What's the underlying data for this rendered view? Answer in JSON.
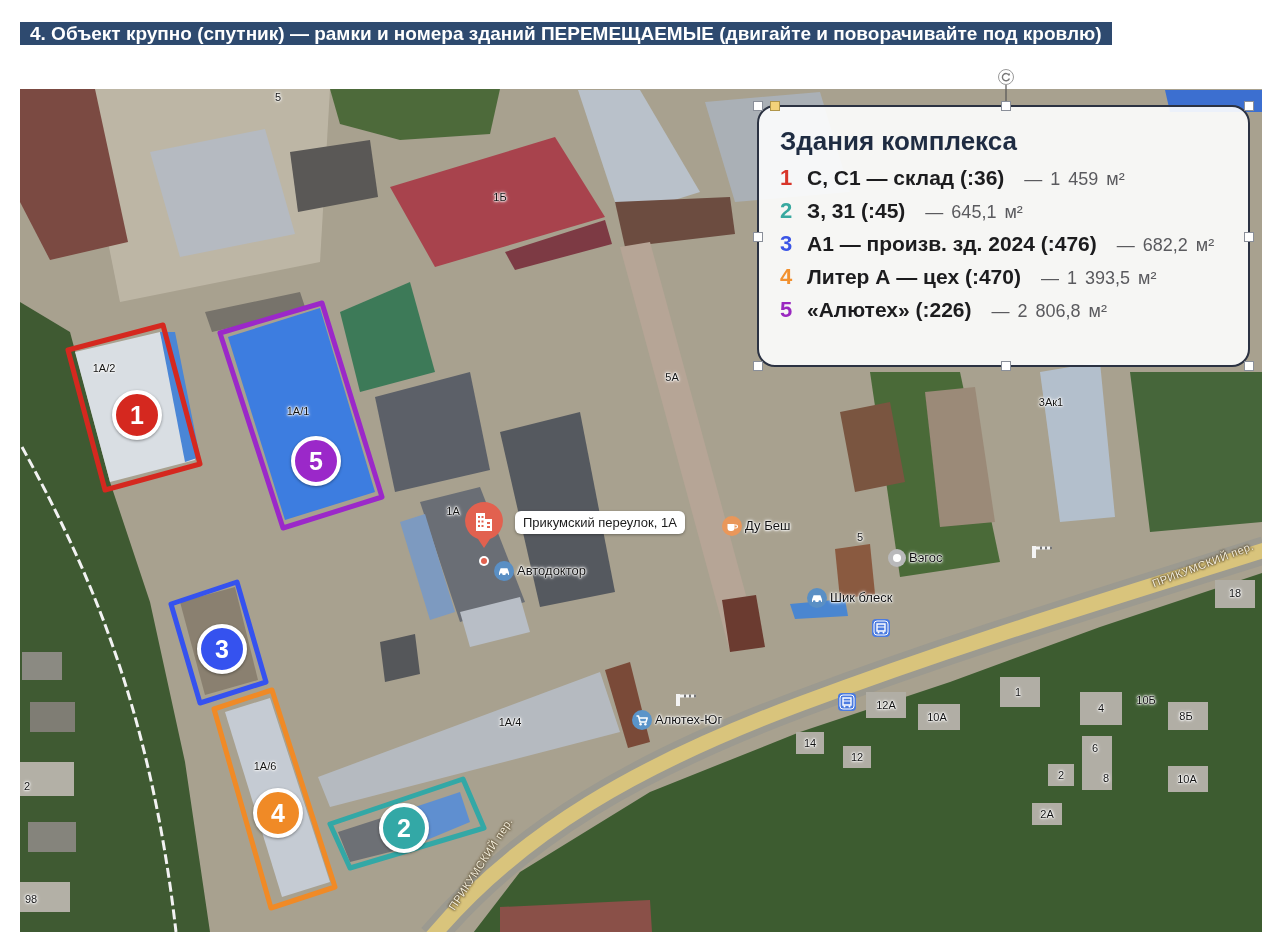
{
  "header": {
    "title": "4. Объект крупно (спутник) — рамки и номера зданий ПЕРЕМЕЩАЕМЫЕ (двигайте и поворачивайте под кровлю)"
  },
  "map": {
    "buildings": [
      {
        "number": "1",
        "color": "#d5281f"
      },
      {
        "number": "2",
        "color": "#33a8a6"
      },
      {
        "number": "3",
        "color": "#3552ef"
      },
      {
        "number": "4",
        "color": "#f08a26"
      },
      {
        "number": "5",
        "color": "#9b28c9"
      }
    ],
    "labels": [
      {
        "kind": "house",
        "text": "5"
      },
      {
        "kind": "house",
        "text": "1Б"
      },
      {
        "kind": "house",
        "text": "1А/2"
      },
      {
        "kind": "house",
        "text": "5А"
      },
      {
        "kind": "house",
        "text": "1А/1"
      },
      {
        "kind": "house",
        "text": "3Ак1"
      },
      {
        "kind": "house",
        "text": "1А"
      },
      {
        "kind": "address",
        "text": "Прикумский переулок, 1А"
      },
      {
        "kind": "cafe",
        "text": "Ду Беш"
      },
      {
        "kind": "house",
        "text": "5"
      },
      {
        "kind": "place",
        "text": "Вэгос"
      },
      {
        "kind": "car_service",
        "text": "Автодоктор"
      },
      {
        "kind": "street",
        "text": "ПРИКУМСКИЙ пер."
      },
      {
        "kind": "car_service",
        "text": "Шик блеск"
      },
      {
        "kind": "house",
        "text": "18"
      },
      {
        "kind": "house",
        "text": "12А"
      },
      {
        "kind": "house",
        "text": "1"
      },
      {
        "kind": "house",
        "text": "4"
      },
      {
        "kind": "house",
        "text": "10Б"
      },
      {
        "kind": "house",
        "text": "1А/4"
      },
      {
        "kind": "shop",
        "text": "Алютех-Юг"
      },
      {
        "kind": "house",
        "text": "10А"
      },
      {
        "kind": "house",
        "text": "8Б"
      },
      {
        "kind": "house",
        "text": "14"
      },
      {
        "kind": "house",
        "text": "6"
      },
      {
        "kind": "house",
        "text": "1А/6"
      },
      {
        "kind": "house",
        "text": "12"
      },
      {
        "kind": "house",
        "text": "2"
      },
      {
        "kind": "house",
        "text": "2"
      },
      {
        "kind": "house",
        "text": "8"
      },
      {
        "kind": "house",
        "text": "10А"
      },
      {
        "kind": "house",
        "text": "2А"
      },
      {
        "kind": "street",
        "text": "ПРИКУМСКИЙ пер."
      },
      {
        "kind": "house",
        "text": "98"
      }
    ],
    "legend": {
      "selected": true,
      "title": "Здания комплекса",
      "items": [
        {
          "number": "1",
          "color": "#d8352a",
          "name": "С, С1 — склад (:36)",
          "area": "— 1 459 м²"
        },
        {
          "number": "2",
          "color": "#38a9a0",
          "name": "З, 31 (:45)",
          "area": "— 645,1 м²"
        },
        {
          "number": "3",
          "color": "#3b55e6",
          "name": "А1 — произв. зд. 2024 (:476)",
          "area": "— 682,2 м²"
        },
        {
          "number": "4",
          "color": "#f2912f",
          "name": "Литер А — цех (:470)",
          "area": "— 1 393,5 м²"
        },
        {
          "number": "5",
          "color": "#9a28c0",
          "name": "«Алютех» (:226)",
          "area": "— 2 806,8 м²"
        }
      ]
    }
  }
}
